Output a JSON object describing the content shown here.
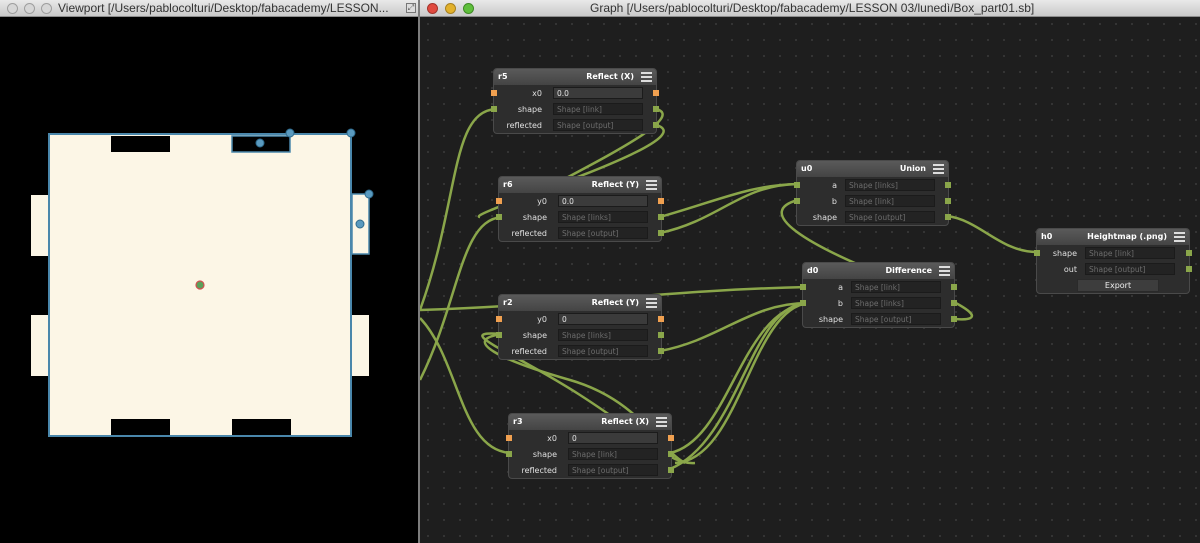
{
  "viewport": {
    "title": "Viewport [/Users/pablocolturi/Desktop/fabacademy/LESSON...",
    "colors": {
      "shape_fill": "#fcf6e6",
      "outline": "#4a87ab",
      "background": "#000000"
    }
  },
  "graph": {
    "title": "Graph [/Users/pablocolturi/Desktop/fabacademy/LESSON 03/lunedì/Box_part01.sb]",
    "link_color": "#8aa64a"
  },
  "nodes": {
    "r5": {
      "id": "r5",
      "type": "Reflect (X)",
      "rows": [
        {
          "label": "x0",
          "value": "0.0"
        },
        {
          "label": "shape",
          "value": "Shape [link]"
        },
        {
          "label": "reflected",
          "value": "Shape [output]"
        }
      ]
    },
    "r6": {
      "id": "r6",
      "type": "Reflect (Y)",
      "rows": [
        {
          "label": "y0",
          "value": "0.0"
        },
        {
          "label": "shape",
          "value": "Shape [links]"
        },
        {
          "label": "reflected",
          "value": "Shape [output]"
        }
      ]
    },
    "r2": {
      "id": "r2",
      "type": "Reflect (Y)",
      "rows": [
        {
          "label": "y0",
          "value": "0"
        },
        {
          "label": "shape",
          "value": "Shape [links]"
        },
        {
          "label": "reflected",
          "value": "Shape [output]"
        }
      ]
    },
    "r3": {
      "id": "r3",
      "type": "Reflect (X)",
      "rows": [
        {
          "label": "x0",
          "value": "0"
        },
        {
          "label": "shape",
          "value": "Shape [link]"
        },
        {
          "label": "reflected",
          "value": "Shape [output]"
        }
      ]
    },
    "u0": {
      "id": "u0",
      "type": "Union",
      "rows": [
        {
          "label": "a",
          "value": "Shape [links]"
        },
        {
          "label": "b",
          "value": "Shape [link]"
        },
        {
          "label": "shape",
          "value": "Shape [output]"
        }
      ]
    },
    "d0": {
      "id": "d0",
      "type": "Difference",
      "rows": [
        {
          "label": "a",
          "value": "Shape [link]"
        },
        {
          "label": "b",
          "value": "Shape [links]"
        },
        {
          "label": "shape",
          "value": "Shape [output]"
        }
      ]
    },
    "h0": {
      "id": "h0",
      "type": "Heightmap (.png)",
      "rows": [
        {
          "label": "shape",
          "value": "Shape [link]"
        },
        {
          "label": "out",
          "value": "Shape [output]"
        }
      ],
      "button": "Export"
    }
  }
}
